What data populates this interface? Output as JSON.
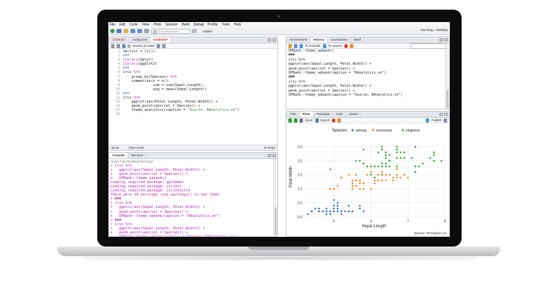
{
  "menu": [
    "File",
    "Edit",
    "Code",
    "View",
    "Plots",
    "Session",
    "Build",
    "Debug",
    "Profile",
    "Tools",
    "Help"
  ],
  "toolbar": {
    "goto_placeholder": "Go to file/function",
    "addins": "Addins",
    "project": "Test blog – Desktop"
  },
  "editor": {
    "tabs": [
      "Untitled1*",
      "config.toml",
      "Untitled2*"
    ],
    "source_on_save": "Source on Save",
    "lines": [
      {
        "n": "1",
        "t": "rm(list = ls())"
      },
      {
        "n": "2",
        "t": "###"
      },
      {
        "n": "3",
        "t": "library(dplyr)"
      },
      {
        "n": "4",
        "t": "library(ggplot2)"
      },
      {
        "n": "5",
        "t": "###"
      },
      {
        "n": "6",
        "t": "iris %>%"
      },
      {
        "n": "7",
        "t": "    group_by(Species) %>%"
      },
      {
        "n": "8",
        "t": "    summarise(n = n(),"
      },
      {
        "n": "9",
        "t": "              sum = sum(Sepal.Length),"
      },
      {
        "n": "10",
        "t": "              avg = mean(Sepal.Length))"
      },
      {
        "n": "11",
        "t": "###"
      },
      {
        "n": "12",
        "t": "iris %>%"
      },
      {
        "n": "13",
        "t": "    ggplot(aes(Petal.Length, Petal.Width)) +"
      },
      {
        "n": "14",
        "t": "    geom_point(aes(col = Species)) +"
      },
      {
        "n": "15",
        "t": "    theme_analytics(caption = \"Source: RAnalytics.vn\")"
      },
      {
        "n": "16",
        "t": ""
      }
    ],
    "status_pos": "15:16",
    "status_level": "(Top Level)",
    "status_type": "R Script"
  },
  "console": {
    "tabs": [
      "Console",
      "Terminal"
    ],
    "path": "D:/My Files/Desktop/Test blog/",
    "lines": [
      {
        "c": "m",
        "t": "> iris %>%"
      },
      {
        "c": "m",
        "t": "+   ggplot(aes(Sepal.Length, Petal.Width)) +"
      },
      {
        "c": "m",
        "t": "+   geom_point(aes(col = Species)) +"
      },
      {
        "c": "m",
        "t": "+   VPBank::theme_vpbank()"
      },
      {
        "c": "m",
        "t": "Loading required package: ggthemes"
      },
      {
        "c": "m",
        "t": "Loading required package: viridis"
      },
      {
        "c": "m",
        "t": "Loading required package: viridisLite"
      },
      {
        "c": "m",
        "t": "There were 19 warnings (use warnings() to see them)"
      },
      {
        "c": "m",
        "t": "> ###"
      },
      {
        "c": "m",
        "t": "> iris %>%"
      },
      {
        "c": "m",
        "t": "+   ggplot(aes(Sepal.Length, Petal.Width)) +"
      },
      {
        "c": "m",
        "t": "+   geom_point(aes(col = Species)) +"
      },
      {
        "c": "m",
        "t": "+   VPBank::theme_vpbank(caption = \"RAnalytics.vn\")"
      },
      {
        "c": "m",
        "t": "> ###"
      },
      {
        "c": "m",
        "t": "> iris %>%"
      },
      {
        "c": "m",
        "t": "+   ggplot(aes(Sepal.Length, Petal.Width)) +"
      },
      {
        "c": "m",
        "t": "+   geom_point(aes(col = Species)) +"
      },
      {
        "c": "m",
        "t": "+   VPBank::theme_vpbank(caption = \"Source: RAnalytics.vn\")"
      },
      {
        "c": "b",
        "t": ">"
      }
    ]
  },
  "env": {
    "tabs": [
      "Environment",
      "History",
      "Connections",
      "Build"
    ],
    "to_console": "To Console",
    "to_source": "To Source",
    "lines": [
      "VPBank::theme_vpbank()",
      "###",
      "iris %>%",
      "ggplot(aes(Sepal.Length, Petal.Width)) +",
      "geom_point(aes(col = Species)) +",
      "VPBank::theme_vpbank(caption = \"RAnalytics.vn\")",
      "###",
      "iris %>%",
      "ggplot(aes(Sepal.Length, Petal.Width)) +",
      "geom_point(aes(col = Species)) +",
      "VPBank::theme_vpbank(caption = \"Source: RAnalytics.vn\")"
    ]
  },
  "files": {
    "tabs": [
      "Files",
      "Plots",
      "Packages",
      "Help",
      "Viewer"
    ],
    "zoom": "Zoom",
    "export": "Export",
    "publish": "Publish"
  },
  "colors": {
    "setosa": "#2f6db6",
    "versicolor": "#ee7d1b",
    "virginica": "#2a9d2e"
  },
  "chart_data": {
    "type": "scatter",
    "legend_title": "Species",
    "legend_position": "top",
    "xlabel": "Sepal Length",
    "ylabel": "Petal Width",
    "caption": "Source: RAnalytics.vn",
    "xlim": [
      4.2,
      8.0
    ],
    "ylim": [
      0.0,
      2.6
    ],
    "xticks": [
      "5",
      "6",
      "7",
      "8"
    ],
    "yticks": [
      "0.0",
      "0.5",
      "1.0",
      "1.5",
      "2.0",
      "2.5"
    ],
    "grid": true,
    "series": [
      {
        "name": "setosa",
        "points": [
          [
            5.1,
            0.2
          ],
          [
            4.9,
            0.2
          ],
          [
            4.7,
            0.2
          ],
          [
            4.6,
            0.2
          ],
          [
            5.0,
            0.2
          ],
          [
            5.4,
            0.4
          ],
          [
            4.6,
            0.3
          ],
          [
            5.0,
            0.2
          ],
          [
            4.4,
            0.2
          ],
          [
            4.9,
            0.1
          ],
          [
            5.4,
            0.2
          ],
          [
            4.8,
            0.2
          ],
          [
            4.8,
            0.1
          ],
          [
            4.3,
            0.1
          ],
          [
            5.8,
            0.2
          ],
          [
            5.7,
            0.4
          ],
          [
            5.4,
            0.4
          ],
          [
            5.1,
            0.3
          ],
          [
            5.7,
            0.3
          ],
          [
            5.1,
            0.3
          ],
          [
            5.4,
            0.2
          ],
          [
            5.1,
            0.4
          ],
          [
            4.6,
            0.2
          ],
          [
            5.1,
            0.5
          ],
          [
            4.8,
            0.2
          ],
          [
            5.0,
            0.2
          ],
          [
            5.0,
            0.4
          ],
          [
            5.2,
            0.2
          ],
          [
            5.2,
            0.2
          ],
          [
            4.7,
            0.2
          ],
          [
            4.8,
            0.2
          ],
          [
            5.4,
            0.4
          ],
          [
            5.2,
            0.1
          ],
          [
            5.5,
            0.2
          ],
          [
            4.9,
            0.2
          ],
          [
            5.0,
            0.2
          ],
          [
            5.5,
            0.2
          ],
          [
            4.9,
            0.1
          ],
          [
            4.4,
            0.2
          ],
          [
            5.1,
            0.2
          ],
          [
            5.0,
            0.3
          ],
          [
            4.5,
            0.3
          ],
          [
            4.4,
            0.2
          ],
          [
            5.0,
            0.6
          ],
          [
            5.1,
            0.4
          ],
          [
            4.8,
            0.3
          ],
          [
            5.1,
            0.2
          ],
          [
            4.6,
            0.2
          ],
          [
            5.3,
            0.2
          ],
          [
            5.0,
            0.2
          ]
        ]
      },
      {
        "name": "versicolor",
        "points": [
          [
            7.0,
            1.4
          ],
          [
            6.4,
            1.5
          ],
          [
            6.9,
            1.5
          ],
          [
            5.5,
            1.3
          ],
          [
            6.5,
            1.5
          ],
          [
            5.7,
            1.3
          ],
          [
            6.3,
            1.6
          ],
          [
            4.9,
            1.0
          ],
          [
            6.6,
            1.3
          ],
          [
            5.2,
            1.4
          ],
          [
            5.0,
            1.0
          ],
          [
            5.9,
            1.5
          ],
          [
            6.0,
            1.0
          ],
          [
            6.1,
            1.4
          ],
          [
            5.6,
            1.3
          ],
          [
            6.7,
            1.4
          ],
          [
            5.6,
            1.5
          ],
          [
            5.8,
            1.0
          ],
          [
            6.2,
            1.5
          ],
          [
            5.6,
            1.1
          ],
          [
            5.9,
            1.8
          ],
          [
            6.1,
            1.3
          ],
          [
            6.3,
            1.5
          ],
          [
            6.1,
            1.2
          ],
          [
            6.4,
            1.3
          ],
          [
            6.6,
            1.4
          ],
          [
            6.8,
            1.4
          ],
          [
            6.7,
            1.7
          ],
          [
            6.0,
            1.5
          ],
          [
            5.7,
            1.0
          ],
          [
            5.5,
            1.1
          ],
          [
            5.5,
            1.0
          ],
          [
            5.8,
            1.2
          ],
          [
            6.0,
            1.6
          ],
          [
            5.4,
            1.5
          ],
          [
            6.0,
            1.6
          ],
          [
            6.7,
            1.5
          ],
          [
            6.3,
            1.3
          ],
          [
            5.6,
            1.3
          ],
          [
            5.5,
            1.3
          ],
          [
            5.5,
            1.2
          ],
          [
            6.1,
            1.4
          ],
          [
            5.8,
            1.2
          ],
          [
            5.0,
            1.0
          ],
          [
            5.6,
            1.3
          ],
          [
            5.7,
            1.2
          ],
          [
            5.7,
            1.3
          ],
          [
            6.2,
            1.3
          ],
          [
            5.1,
            1.1
          ],
          [
            5.7,
            1.3
          ]
        ]
      },
      {
        "name": "virginica",
        "points": [
          [
            6.3,
            2.5
          ],
          [
            5.8,
            1.9
          ],
          [
            7.1,
            2.1
          ],
          [
            6.3,
            1.8
          ],
          [
            6.5,
            2.2
          ],
          [
            7.6,
            2.1
          ],
          [
            4.9,
            1.7
          ],
          [
            7.3,
            1.8
          ],
          [
            6.7,
            1.8
          ],
          [
            7.2,
            2.5
          ],
          [
            6.5,
            2.0
          ],
          [
            6.4,
            1.9
          ],
          [
            6.8,
            2.1
          ],
          [
            5.7,
            2.0
          ],
          [
            5.8,
            2.4
          ],
          [
            6.4,
            2.3
          ],
          [
            6.5,
            1.8
          ],
          [
            7.7,
            2.2
          ],
          [
            7.7,
            2.3
          ],
          [
            6.0,
            1.5
          ],
          [
            6.9,
            2.3
          ],
          [
            5.6,
            2.0
          ],
          [
            7.7,
            2.0
          ],
          [
            6.3,
            1.8
          ],
          [
            6.7,
            2.1
          ],
          [
            7.2,
            1.8
          ],
          [
            6.2,
            1.8
          ],
          [
            6.1,
            1.8
          ],
          [
            6.4,
            2.1
          ],
          [
            7.2,
            1.6
          ],
          [
            7.4,
            1.9
          ],
          [
            7.9,
            2.0
          ],
          [
            6.4,
            2.2
          ],
          [
            6.3,
            1.5
          ],
          [
            6.1,
            1.4
          ],
          [
            7.7,
            2.3
          ],
          [
            6.3,
            2.4
          ],
          [
            6.4,
            1.8
          ],
          [
            6.0,
            1.8
          ],
          [
            6.9,
            2.1
          ],
          [
            6.7,
            2.4
          ],
          [
            6.9,
            2.3
          ],
          [
            5.8,
            1.9
          ],
          [
            6.8,
            2.3
          ],
          [
            6.7,
            2.5
          ],
          [
            6.7,
            2.3
          ],
          [
            6.3,
            1.9
          ],
          [
            6.5,
            2.0
          ],
          [
            6.2,
            2.3
          ],
          [
            5.9,
            1.8
          ]
        ]
      }
    ]
  }
}
